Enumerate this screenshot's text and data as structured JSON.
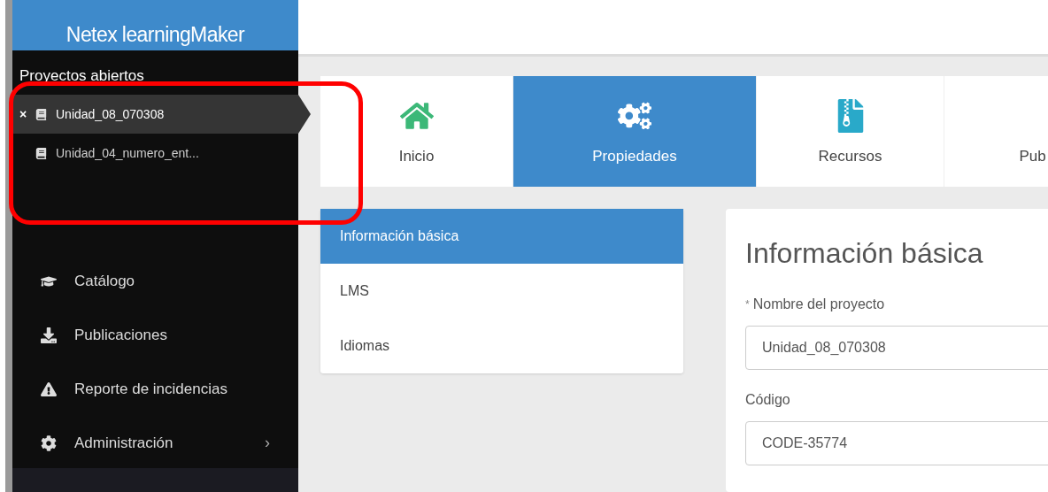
{
  "app": {
    "title": "Netex learningMaker"
  },
  "open_projects": {
    "heading": "Proyectos abiertos",
    "items": [
      {
        "name": "Unidad_08_070308",
        "selected": true,
        "close": "×"
      },
      {
        "name": "Unidad_04_numero_ent...",
        "selected": false
      }
    ]
  },
  "menu": [
    {
      "label": "Catálogo",
      "kind": "catalog"
    },
    {
      "label": "Publicaciones",
      "kind": "publications"
    },
    {
      "label": "Reporte de incidencias",
      "kind": "issues"
    },
    {
      "label": "Administración",
      "kind": "admin",
      "chevron": "›"
    }
  ],
  "tabs": [
    {
      "label": "Inicio",
      "kind": "home",
      "selected": false
    },
    {
      "label": "Propiedades",
      "kind": "properties",
      "selected": true
    },
    {
      "label": "Recursos",
      "kind": "resources",
      "selected": false
    },
    {
      "label": "Pub",
      "kind": "publish",
      "selected": false
    }
  ],
  "sections": [
    {
      "label": "Información básica",
      "selected": true
    },
    {
      "label": "LMS",
      "selected": false
    },
    {
      "label": "Idiomas",
      "selected": false
    }
  ],
  "form": {
    "title": "Información básica",
    "fields": [
      {
        "label": "Nombre del proyecto",
        "marker": "*",
        "value": "Unidad_08_070308"
      },
      {
        "label": "Código",
        "value": "CODE-35774"
      }
    ]
  }
}
